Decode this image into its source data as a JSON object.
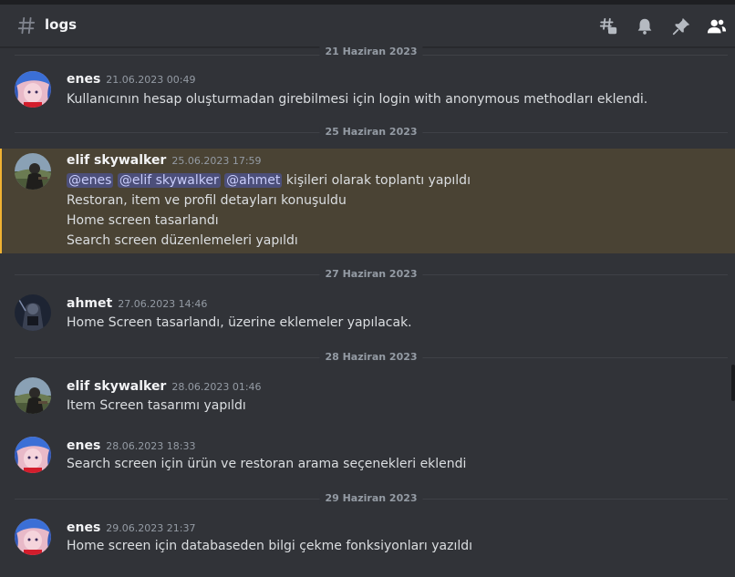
{
  "header": {
    "channel_name": "logs",
    "icons": [
      "threads-icon",
      "bell-icon",
      "pin-icon",
      "members-icon"
    ]
  },
  "dividers": [
    "21 Haziran 2023",
    "25 Haziran 2023",
    "27 Haziran 2023",
    "28 Haziran 2023",
    "29 Haziran 2023"
  ],
  "messages": [
    {
      "author": "enes",
      "timestamp": "21.06.2023 00:49",
      "lines": [
        "Kullanıcının hesap oluşturmadan girebilmesi için login with anonymous methodları eklendi."
      ]
    },
    {
      "author": "elif skywalker",
      "timestamp": "25.06.2023 17:59",
      "mentions": [
        "@enes",
        "@elif skywalker",
        "@ahmet"
      ],
      "mention_suffix": "kişileri olarak toplantı yapıldı",
      "lines": [
        "Restoran, item ve profil detayları konuşuldu",
        "Home screen tasarlandı",
        "Search screen düzenlemeleri yapıldı"
      ]
    },
    {
      "author": "ahmet",
      "timestamp": "27.06.2023 14:46",
      "lines": [
        "Home Screen tasarlandı, üzerine eklemeler yapılacak."
      ]
    },
    {
      "author": "elif skywalker",
      "timestamp": "28.06.2023 01:46",
      "lines": [
        "Item Screen tasarımı yapıldı"
      ]
    },
    {
      "author": "enes",
      "timestamp": "28.06.2023 18:33",
      "lines": [
        "Search screen için ürün ve restoran arama seçenekleri eklendi"
      ]
    },
    {
      "author": "enes",
      "timestamp": "29.06.2023 21:37",
      "lines": [
        "Home screen için databaseden bilgi çekme fonksiyonları yazıldı"
      ]
    }
  ],
  "colors": {
    "background": "#313338",
    "highlight": "#4a4334",
    "highlight_bar": "#f0b232",
    "mention_bg": "#4c4f7a",
    "mention_text": "#c9cdfb"
  }
}
